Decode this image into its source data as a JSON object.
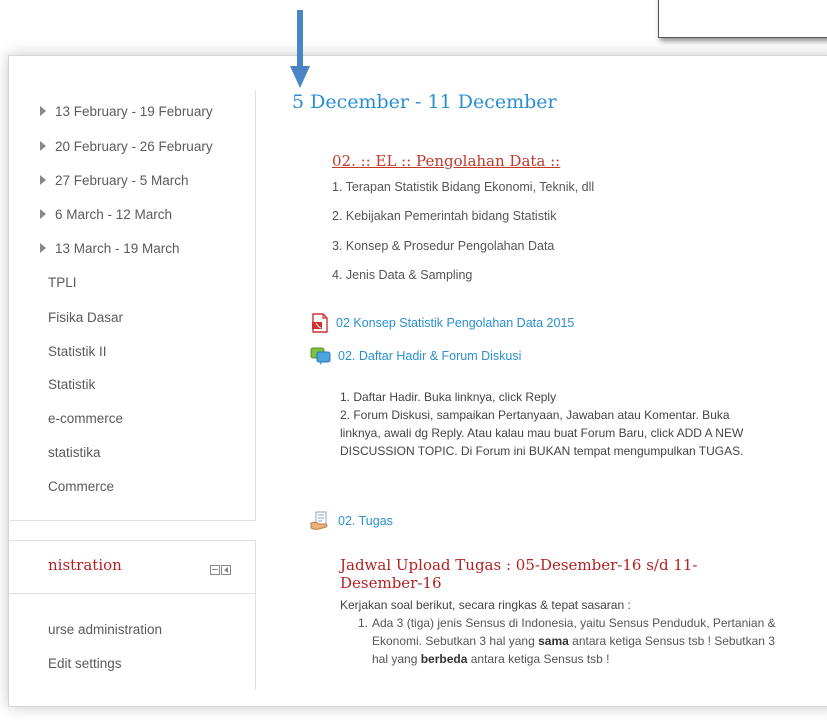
{
  "left_nav": {
    "weeks": [
      "13 February - 19 February",
      "20 February - 26 February",
      "27 February - 5 March",
      "6 March - 12 March",
      "13 March - 19 March"
    ],
    "courses": [
      "TPLI",
      "Fisika Dasar",
      "Statistik II",
      "Statistik",
      "e-commerce",
      "statistika",
      "Commerce"
    ]
  },
  "administration": {
    "title": "nistration",
    "items": [
      "urse administration",
      "Edit settings"
    ]
  },
  "main": {
    "section_title": "5 December - 11 December",
    "topic": {
      "title": "02. :: EL :: Pengolahan Data ::",
      "items": [
        "1. Terapan Statistik Bidang Ekonomi, Teknik, dll",
        "2. Kebijakan Pemerintah bidang Statistik",
        "3. Konsep & Prosedur Pengolahan Data",
        "4. Jenis Data & Sampling"
      ]
    },
    "resources": {
      "pdf_label": "02 Konsep Statistik Pengolahan Data 2015",
      "forum_label": "02. Daftar Hadir & Forum Diskusi",
      "assign_label": "02. Tugas"
    },
    "forum_desc": {
      "line1": "1. Daftar Hadir. Buka linknya, click Reply",
      "line2": "2. Forum Diskusi, sampaikan Pertanyaan, Jawaban atau Komentar. Buka linknya, awali dg Reply. Atau kalau mau buat Forum Baru, click ADD A NEW DISCUSSION TOPIC. Di Forum ini BUKAN tempat mengumpulkan TUGAS."
    },
    "assignment": {
      "title": "Jadwal Upload Tugas : 05-Desember-16 s/d 11-Desember-16",
      "instructions": "Kerjakan soal berikut, secara ringkas & tepat sasaran :",
      "item_num": "1.",
      "item_part1": "Ada 3 (tiga) jenis Sensus di Indonesia, yaitu Sensus Penduduk, Pertanian & Ekonomi. Sebutkan 3 hal yang",
      "bold1": "sama",
      "item_part2": "antara ketiga Sensus tsb ! Sebutkan 3 hal yang",
      "bold2": "berbeda",
      "item_part3": "antara ketiga Sensus tsb !"
    }
  },
  "colors": {
    "link_blue": "#2a8fd0",
    "title_red": "#b22222",
    "arrow_blue": "#4a86c5"
  },
  "icons": [
    "pdf-icon",
    "forum-icon",
    "assignment-icon",
    "blue-arrow-icon"
  ]
}
